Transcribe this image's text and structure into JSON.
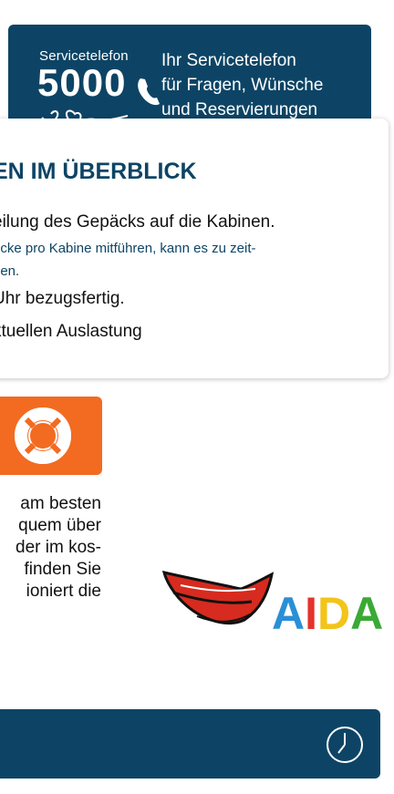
{
  "service": {
    "small": "Servicetelefon",
    "number": "5000",
    "lines": [
      "Ihr Servicetelefon",
      "für Fragen, Wünsche",
      "und Reservierungen"
    ]
  },
  "card": {
    "title": "EN IM ÜBERBLICK",
    "line1": "eilung des Gepäcks auf die Kabinen.",
    "note1": "ücke pro Kabine mitführen, kann es zu zeit-",
    "note2": "nen.",
    "line2": " Uhr bezugsfertig.",
    "line3": "ktuellen Auslastung"
  },
  "body": {
    "lines": [
      "am besten",
      "quem über",
      "der im kos-",
      "finden Sie",
      "ioniert die"
    ]
  },
  "logo": {
    "text": "AIDA"
  },
  "colors": {
    "navy": "#0d4465",
    "orange": "#f26b21",
    "lips": "#d62b1e"
  }
}
